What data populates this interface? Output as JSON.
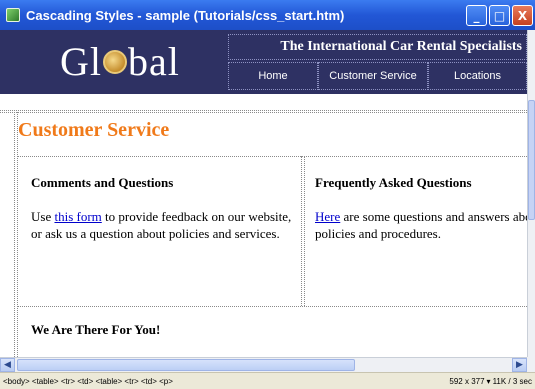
{
  "window": {
    "title": "Cascading Styles - sample (Tutorials/css_start.htm)",
    "buttons": {
      "minimize": "_",
      "maximize": "□",
      "close": "X"
    }
  },
  "header": {
    "logo_parts": [
      "Gl",
      "bal"
    ],
    "tagline": "The International Car Rental Specialists",
    "nav": [
      "Home",
      "Customer Service",
      "Locations"
    ],
    "colors": {
      "band": "#2e3163",
      "text": "#ffffff"
    }
  },
  "content": {
    "heading": "Customer Service",
    "heading_color": "#f07a1a",
    "left": {
      "heading": "Comments and Questions",
      "text_before": "Use ",
      "link": "this form",
      "text_after": " to provide feedback on our website, or ask us a question about policies and services."
    },
    "right": {
      "heading": "Frequently Asked Questions",
      "link": "Here",
      "text_after": " are some questions and answers about Global's policies and procedures."
    },
    "bottom_heading": "We Are There For You!"
  },
  "scrollbar": {
    "arrows": {
      "left": "◀",
      "right": "▶"
    }
  },
  "statusbar": {
    "tag_selector": "<body> <table> <tr> <td> <table> <tr> <td> <p>",
    "window_size": "592 x 377",
    "size_arrow": "▾",
    "download": "11K / 3 sec"
  }
}
